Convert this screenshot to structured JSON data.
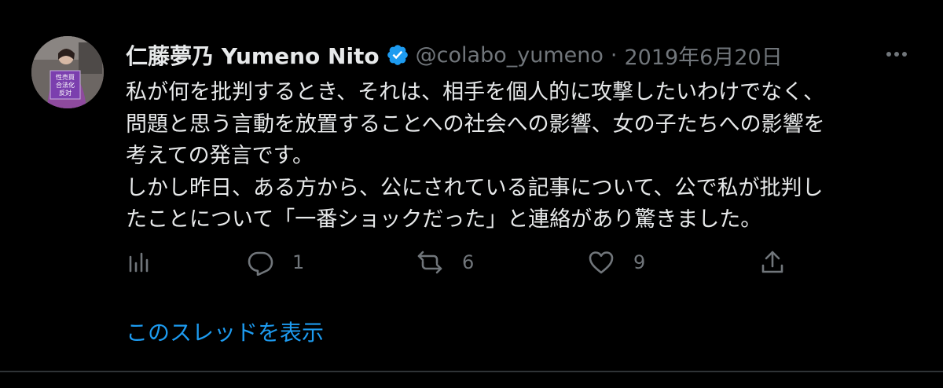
{
  "tweet": {
    "author": {
      "display_name": "仁藤夢乃 Yumeno Nito",
      "handle": "@colabo_yumeno",
      "verified": true,
      "avatar_sign_text": [
        "性売買",
        "合法化",
        "反対"
      ]
    },
    "separator": "·",
    "date": "2019年6月20日",
    "body_lines": [
      "私が何を批判するとき、それは、相手を個人的に攻撃したいわけでなく、",
      "問題と思う言動を放置することへの社会への影響、女の子たちへの影響を",
      "考えての発言です。",
      "しかし昨日、ある方から、公にされている記事について、公で私が批判し",
      "たことについて「一番ショックだった」と連絡があり驚きました。"
    ],
    "actions": {
      "analytics_icon": "analytics-icon",
      "reply": {
        "icon": "reply-icon",
        "count": "1"
      },
      "retweet": {
        "icon": "retweet-icon",
        "count": "6"
      },
      "like": {
        "icon": "heart-icon",
        "count": "9"
      },
      "share_icon": "share-icon"
    },
    "show_thread_label": "このスレッドを表示"
  },
  "colors": {
    "background": "#000000",
    "text": "#e7e9ea",
    "muted": "#71767b",
    "accent": "#1d9bf0",
    "border": "#2f3336",
    "sign_purple": "#7b3fae"
  }
}
